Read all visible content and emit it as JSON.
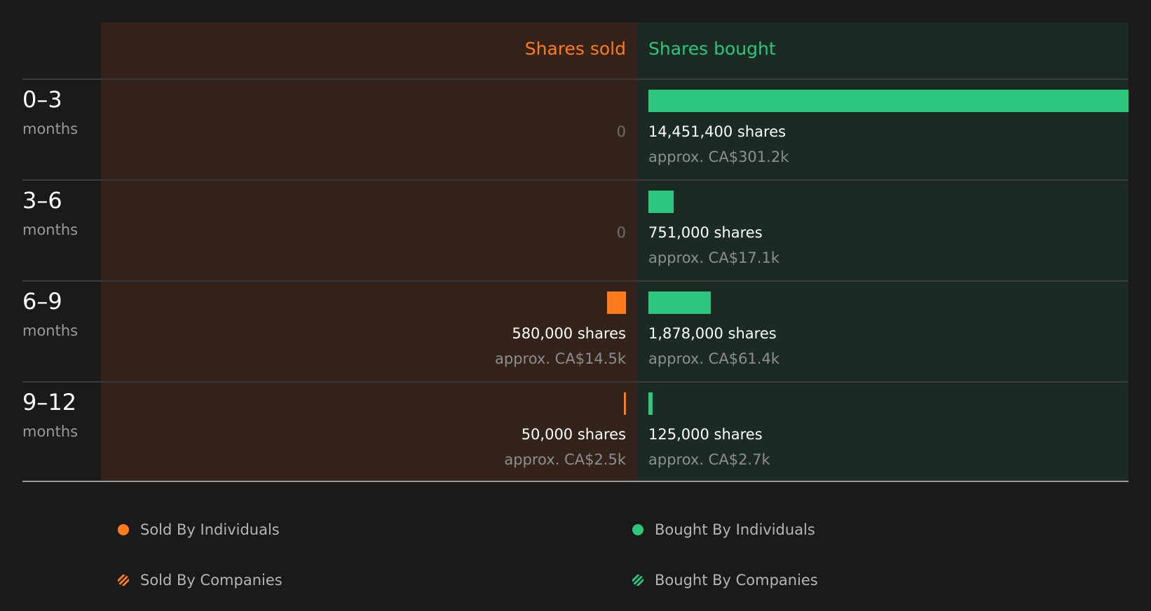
{
  "colors": {
    "sold": "#ff7a1a",
    "bought": "#2ec67e",
    "sold_bg": "#33231b",
    "bought_bg": "#1b2a23"
  },
  "chart_data": {
    "type": "bar",
    "headers": {
      "sold": "Shares sold",
      "bought": "Shares bought"
    },
    "categories": [
      {
        "period": "0–3",
        "unit": "months"
      },
      {
        "period": "3–6",
        "unit": "months"
      },
      {
        "period": "6–9",
        "unit": "months"
      },
      {
        "period": "9–12",
        "unit": "months"
      }
    ],
    "series": [
      {
        "name": "Shares sold",
        "values": [
          0,
          0,
          580000,
          50000
        ],
        "labels": [
          "0",
          "0",
          "580,000 shares",
          "50,000 shares"
        ],
        "approx": [
          "",
          "",
          "approx. CA$14.5k",
          "approx. CA$2.5k"
        ]
      },
      {
        "name": "Shares bought",
        "values": [
          14451400,
          751000,
          1878000,
          125000
        ],
        "labels": [
          "14,451,400 shares",
          "751,000 shares",
          "1,878,000 shares",
          "125,000 shares"
        ],
        "approx": [
          "approx. CA$301.2k",
          "approx. CA$17.1k",
          "approx. CA$61.4k",
          "approx. CA$2.7k"
        ]
      }
    ],
    "max_value": 14451400,
    "legend": [
      {
        "label": "Sold By Individuals",
        "style": "solid",
        "color": "#ff7a1a"
      },
      {
        "label": "Bought By Individuals",
        "style": "solid",
        "color": "#2ec67e"
      },
      {
        "label": "Sold By Companies",
        "style": "hatched",
        "color": "#ff7a1a"
      },
      {
        "label": "Bought By Companies",
        "style": "hatched",
        "color": "#2ec67e"
      }
    ]
  }
}
